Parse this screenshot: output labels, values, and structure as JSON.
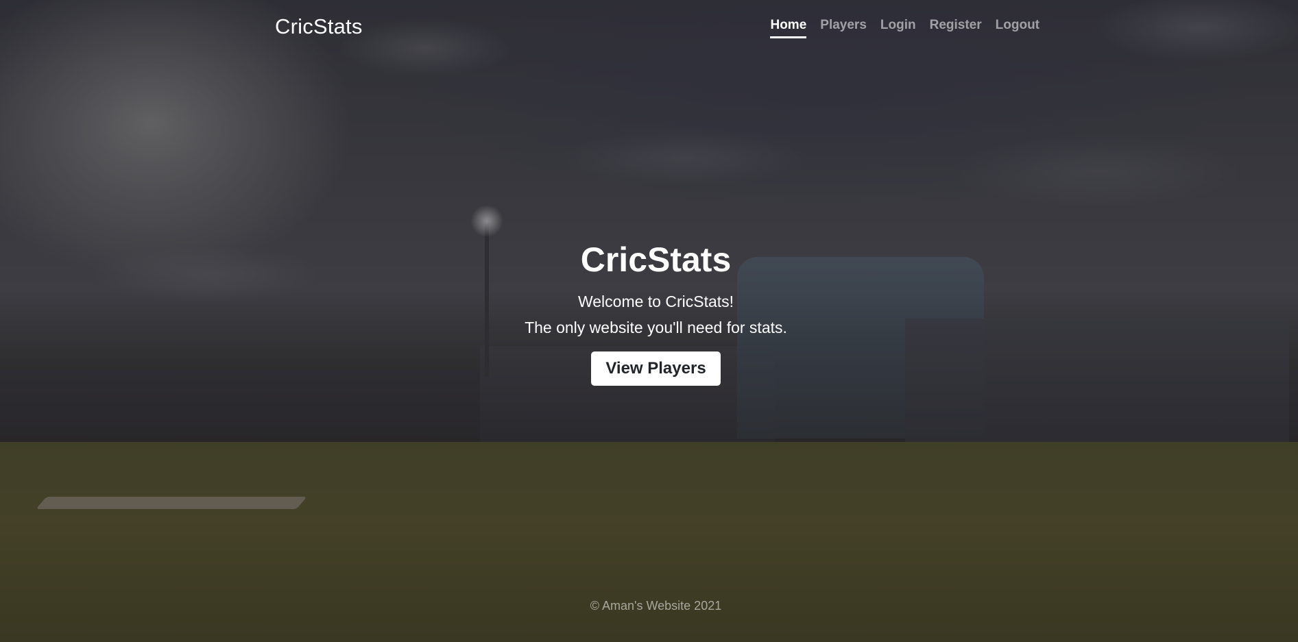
{
  "navbar": {
    "brand": "CricStats",
    "links": [
      {
        "label": "Home",
        "active": true
      },
      {
        "label": "Players",
        "active": false
      },
      {
        "label": "Login",
        "active": false
      },
      {
        "label": "Register",
        "active": false
      },
      {
        "label": "Logout",
        "active": false
      }
    ]
  },
  "hero": {
    "title": "CricStats",
    "line1": "Welcome to CricStats!",
    "line2": "The only website you'll need for stats.",
    "button_label": "View Players"
  },
  "footer": {
    "text": "© Aman's Website 2021"
  },
  "background": {
    "description_icon": "cricket-stadium-image"
  }
}
